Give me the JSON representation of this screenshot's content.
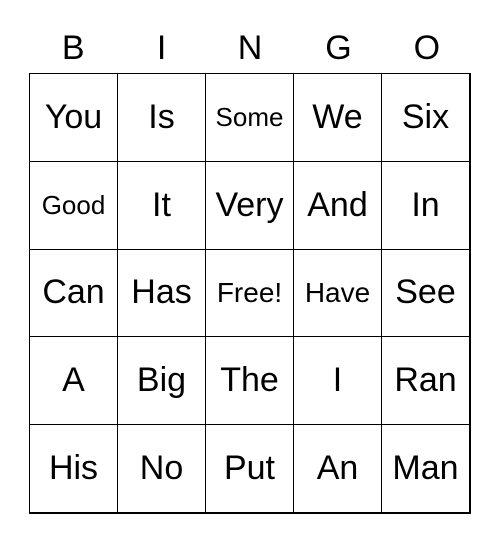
{
  "header": [
    "B",
    "I",
    "N",
    "G",
    "O"
  ],
  "cells": [
    [
      "You",
      "Is",
      "Some",
      "We",
      "Six"
    ],
    [
      "Good",
      "It",
      "Very",
      "And",
      "In"
    ],
    [
      "Can",
      "Has",
      "Free!",
      "Have",
      "See"
    ],
    [
      "A",
      "Big",
      "The",
      "I",
      "Ran"
    ],
    [
      "His",
      "No",
      "Put",
      "An",
      "Man"
    ]
  ]
}
